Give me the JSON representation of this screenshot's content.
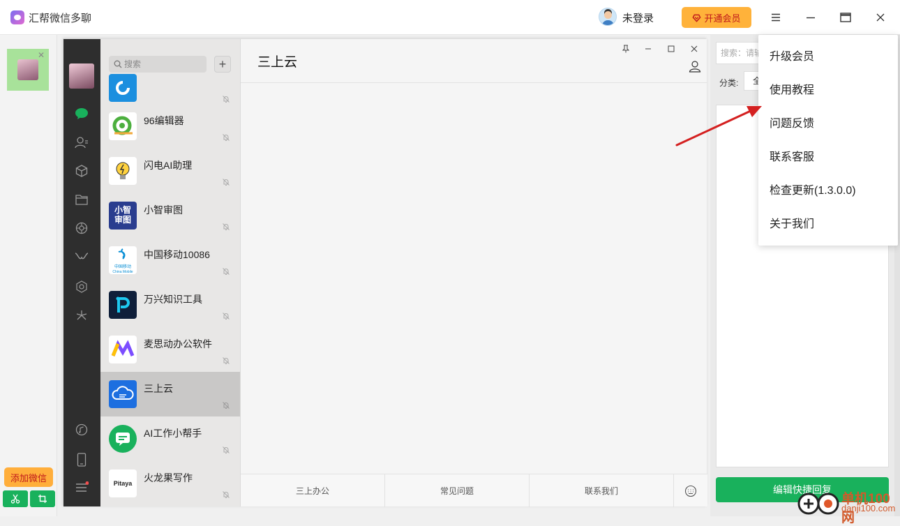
{
  "app": {
    "title": "汇帮微信多聊",
    "login_status": "未登录",
    "vip_button": "开通会员"
  },
  "left_strip": {
    "add_wechat": "添加微信"
  },
  "wechat": {
    "search_placeholder": "搜索",
    "chat_title": "三上云",
    "chats": [
      {
        "name": "",
        "selected": false
      },
      {
        "name": "96编辑器",
        "selected": false
      },
      {
        "name": "闪电AI助理",
        "selected": false
      },
      {
        "name": "小智审图",
        "selected": false,
        "icon_text": "小智审图"
      },
      {
        "name": "中国移动10086",
        "selected": false
      },
      {
        "name": "万兴知识工具",
        "selected": false
      },
      {
        "name": "麦思动办公软件",
        "selected": false
      },
      {
        "name": "三上云",
        "selected": true
      },
      {
        "name": "AI工作小帮手",
        "selected": false
      },
      {
        "name": "火龙果写作",
        "selected": false,
        "icon_text": "Pitaya"
      }
    ],
    "china_mobile_icon_text": "中国移动",
    "china_mobile_icon_sub": "China Mobile",
    "xiaozhi_icon_line1": "小智",
    "xiaozhi_icon_line2": "审图",
    "bottom_tabs": [
      "三上办公",
      "常见问题",
      "联系我们"
    ]
  },
  "right_panel": {
    "search_placeholder": "搜索：请输",
    "category_label": "分类:",
    "category_value": "全",
    "edit_button": "编辑快捷回复"
  },
  "menu": {
    "items": [
      "升级会员",
      "使用教程",
      "问题反馈",
      "联系客服",
      "检查更新(1.3.0.0)",
      "关于我们"
    ]
  },
  "watermark": {
    "text": "单机100网",
    "sub": "danji100.com"
  },
  "colors": {
    "vip_bg": "#ffb23a",
    "green": "#19b15c",
    "wechat_nav": "#2e2e2e",
    "arrow": "#d42020"
  }
}
